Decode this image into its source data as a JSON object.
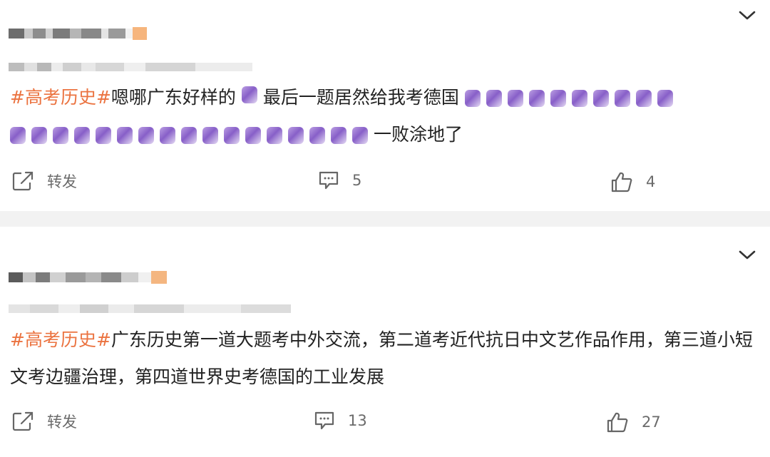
{
  "posts": [
    {
      "text": {
        "hashtag": "#高考历史#",
        "body_before_emoji": "嗯哪广东好样的",
        "body_middle": "最后一题居然给我考德国",
        "body_after_emoji": "一败涂地了"
      },
      "actions": {
        "repost_label": "转发",
        "comment_count": "5",
        "like_count": "4"
      }
    },
    {
      "text": {
        "hashtag": "#高考历史#",
        "body": "广东历史第一道大题考中外交流，第二道考近代抗日中文艺作品作用，第三道小短文考边疆治理，第四道世界史考德国的工业发展"
      },
      "actions": {
        "repost_label": "转发",
        "comment_count": "13",
        "like_count": "27"
      }
    }
  ],
  "colors": {
    "hashtag": "#eb7340",
    "divider": "#f2f2f2",
    "action_text": "#6b6b6b"
  },
  "icons": {
    "menu": "chevron-down-icon",
    "repost": "share-icon",
    "comment": "comment-icon",
    "like": "thumbs-up-icon"
  }
}
